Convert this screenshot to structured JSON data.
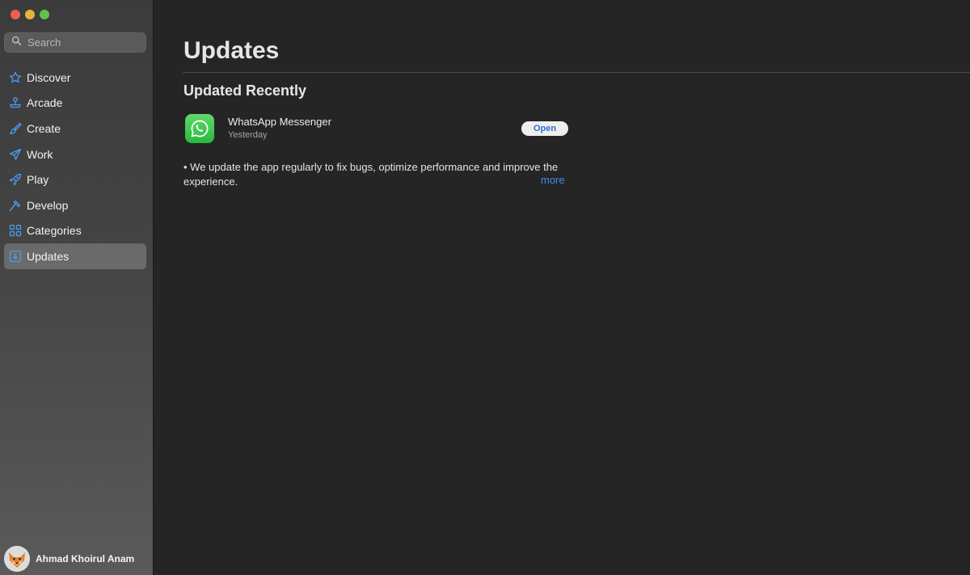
{
  "window": {
    "controls": [
      "close",
      "minimize",
      "zoom"
    ]
  },
  "search": {
    "placeholder": "Search",
    "icon": "search-icon"
  },
  "sidebar": {
    "items": [
      {
        "label": "Discover",
        "icon": "star-icon"
      },
      {
        "label": "Arcade",
        "icon": "joystick-icon"
      },
      {
        "label": "Create",
        "icon": "brush-icon"
      },
      {
        "label": "Work",
        "icon": "paper-plane-icon"
      },
      {
        "label": "Play",
        "icon": "rocket-icon"
      },
      {
        "label": "Develop",
        "icon": "hammer-icon"
      },
      {
        "label": "Categories",
        "icon": "grid-icon"
      },
      {
        "label": "Updates",
        "icon": "download-icon",
        "active": true
      }
    ]
  },
  "user": {
    "name": "Ahmad Khoirul Anam",
    "avatar": "fox-avatar"
  },
  "main": {
    "title": "Updates",
    "section_title": "Updated Recently",
    "app": {
      "name": "WhatsApp Messenger",
      "date": "Yesterday",
      "button_label": "Open",
      "icon": "whatsapp-icon",
      "notes": "• We update the app regularly to fix bugs, optimize performance and improve the experience.",
      "more_label": "more"
    }
  },
  "colors": {
    "accent": "#3f8cf0",
    "sidebar_icon": "#4a9bf4",
    "background": "#252525",
    "app_icon": "#33c24a"
  }
}
